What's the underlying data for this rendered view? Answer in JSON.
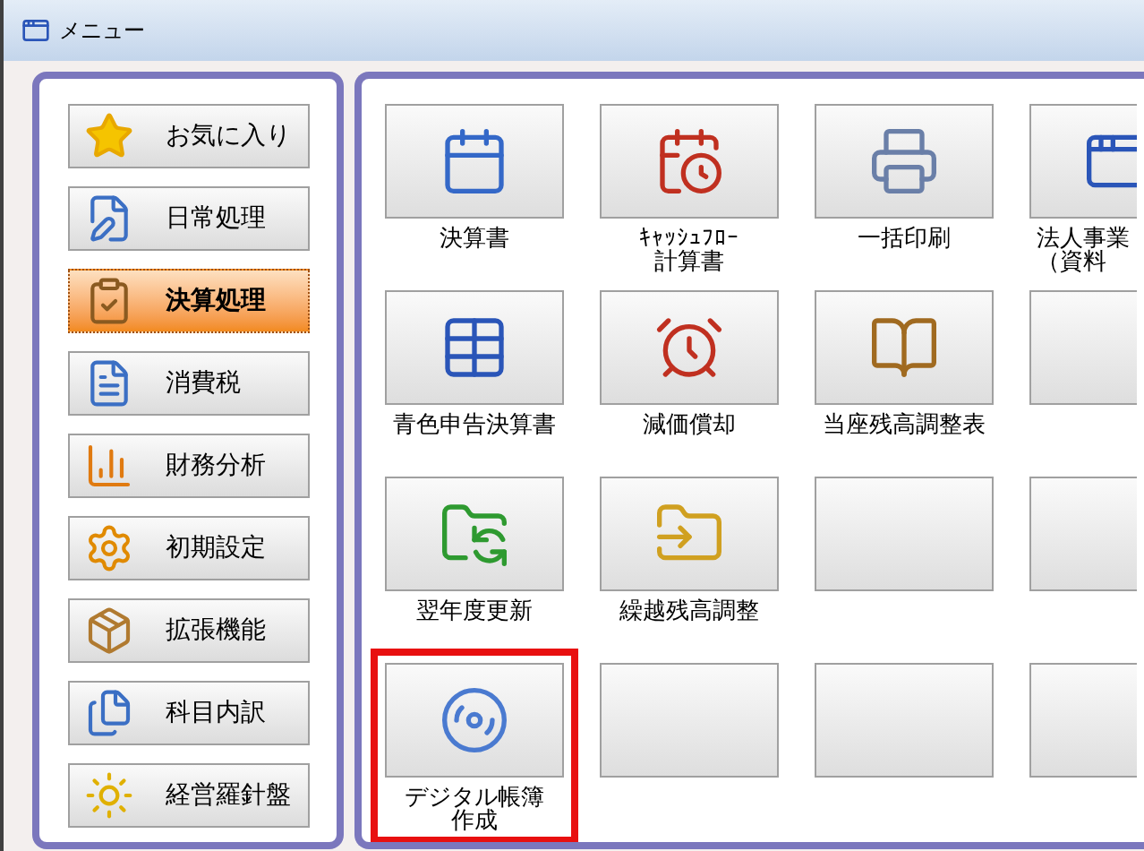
{
  "window": {
    "title": "メニュー"
  },
  "sidebar": {
    "items": [
      {
        "label": "お気に入り",
        "selected": false
      },
      {
        "label": "日常処理",
        "selected": false
      },
      {
        "label": "決算処理",
        "selected": true
      },
      {
        "label": "消費税",
        "selected": false
      },
      {
        "label": "財務分析",
        "selected": false
      },
      {
        "label": "初期設定",
        "selected": false
      },
      {
        "label": "拡張機能",
        "selected": false
      },
      {
        "label": "科目内訳",
        "selected": false
      },
      {
        "label": "経営羅針盤",
        "selected": false
      }
    ]
  },
  "tools": [
    {
      "kind": "tool",
      "lines": [
        "決算書"
      ],
      "highlighted": false
    },
    {
      "kind": "tool",
      "lines": [
        "ｷｬｯｼｭﾌﾛｰ",
        "計算書"
      ],
      "highlighted": false
    },
    {
      "kind": "tool",
      "lines": [
        "一括印刷"
      ],
      "highlighted": false
    },
    {
      "kind": "tool",
      "lines": [
        "法人事業",
        "（資料"
      ],
      "highlighted": false
    },
    {
      "kind": "tool",
      "lines": [
        "青色申告決算書"
      ],
      "highlighted": false
    },
    {
      "kind": "tool",
      "lines": [
        "減価償却"
      ],
      "highlighted": false
    },
    {
      "kind": "tool",
      "lines": [
        "当座残高調整表"
      ],
      "highlighted": false
    },
    {
      "kind": "empty"
    },
    {
      "kind": "tool",
      "lines": [
        "翌年度更新"
      ],
      "highlighted": false
    },
    {
      "kind": "tool",
      "lines": [
        "繰越残高調整"
      ],
      "highlighted": false
    },
    {
      "kind": "empty"
    },
    {
      "kind": "empty"
    },
    {
      "kind": "tool",
      "lines": [
        "デジタル帳簿",
        "作成"
      ],
      "highlighted": true
    },
    {
      "kind": "empty"
    },
    {
      "kind": "empty"
    },
    {
      "kind": "empty"
    }
  ]
}
